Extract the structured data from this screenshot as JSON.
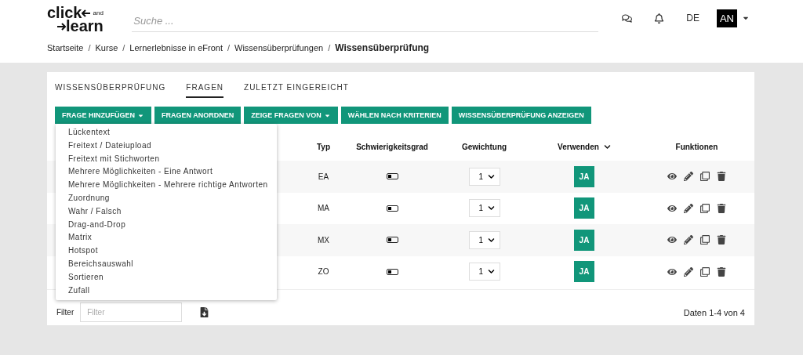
{
  "header": {
    "logo_top": "click",
    "logo_and": "and",
    "logo_bottom": "learn",
    "search": {
      "placeholder": "Suche ..."
    },
    "language": "DE",
    "user_initials": "AN"
  },
  "breadcrumb_separator": "/",
  "breadcrumb": [
    {
      "label": "Startseite",
      "current": false
    },
    {
      "label": "Kurse",
      "current": false
    },
    {
      "label": "Lernerlebnisse in eFront",
      "current": false
    },
    {
      "label": "Wissensüberprüfungen",
      "current": false
    },
    {
      "label": "Wissensüberprüfung",
      "current": true
    }
  ],
  "tabs": [
    {
      "label": "WISSENSÜBERPRÜFUNG",
      "selected": false
    },
    {
      "label": "FRAGEN",
      "selected": true
    },
    {
      "label": "ZULETZT EINGEREICHT",
      "selected": false
    }
  ],
  "toolbar": [
    {
      "label": "FRAGE HINZUFÜGEN",
      "dropdown": true
    },
    {
      "label": "FRAGEN ANORDNEN",
      "dropdown": false
    },
    {
      "label": "ZEIGE FRAGEN VON",
      "dropdown": true
    },
    {
      "label": "WÄHLEN NACH KRITERIEN",
      "dropdown": false
    },
    {
      "label": "WISSENSÜBERPRÜFUNG ANZEIGEN",
      "dropdown": false
    }
  ],
  "add_menu": [
    "Lückentext",
    "Freitext / Dateiupload",
    "Freitext mit Stichworten",
    "Mehrere Möglichkeiten - Eine Antwort",
    "Mehrere Möglichkeiten - Mehrere richtige Antworten",
    "Zuordnung",
    "Wahr / Falsch",
    "Drag-and-Drop",
    "Matrix",
    "Hotspot",
    "Bereichsauswahl",
    "Sortieren",
    "Zufall"
  ],
  "table": {
    "columns": [
      "Typ",
      "Schwierigkeitsgrad",
      "Gewichtung",
      "Verwenden",
      "Funktionen"
    ],
    "rows": [
      {
        "type": "EA",
        "level": 0.4,
        "weight": "1",
        "use": "JA"
      },
      {
        "type": "MA",
        "level": 0.4,
        "weight": "1",
        "use": "JA"
      },
      {
        "type": "MX",
        "level": 0.4,
        "weight": "1",
        "use": "JA"
      },
      {
        "type": "ZO",
        "level": 0.4,
        "weight": "1",
        "use": "JA"
      }
    ]
  },
  "footer": {
    "filter_label": "Filter",
    "filter_placeholder": "Filter",
    "summary": "Daten 1-4 von 4"
  }
}
